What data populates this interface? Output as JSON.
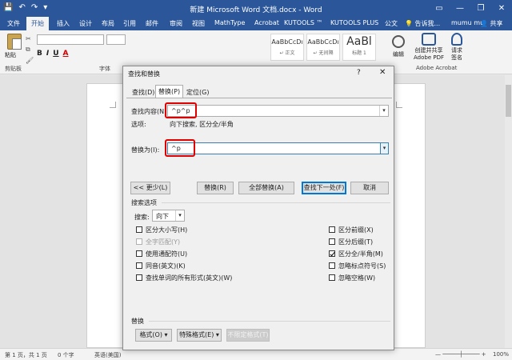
{
  "window": {
    "title": "新建 Microsoft Word 文档.docx - Word",
    "quick_access": [
      "💾",
      "↶",
      "↷",
      "▾"
    ],
    "controls": [
      "▭",
      "—",
      "❐",
      "✕"
    ]
  },
  "tabs": [
    {
      "label": "文件"
    },
    {
      "label": "开始"
    },
    {
      "label": "插入"
    },
    {
      "label": "设计"
    },
    {
      "label": "布局"
    },
    {
      "label": "引用"
    },
    {
      "label": "邮件"
    },
    {
      "label": "审阅"
    },
    {
      "label": "视图"
    },
    {
      "label": "MathType"
    },
    {
      "label": "Acrobat"
    },
    {
      "label": "KUTOOLS ™"
    },
    {
      "label": "KUTOOLS PLUS"
    },
    {
      "label": "公文"
    }
  ],
  "tell_me": "💡 告诉我...",
  "user": "mumu mu",
  "share": "👤 共享",
  "ribbon": {
    "paste_label": "粘贴",
    "clipboard_label": "剪贴板",
    "font_group_label": "字体",
    "bold": "B",
    "italic": "I",
    "underline": "U",
    "font_color": "A",
    "styles": [
      {
        "sample": "AaBbCcDı",
        "name": "↵ 正文"
      },
      {
        "sample": "AaBbCcDı",
        "name": "↵ 无间隔"
      },
      {
        "sample": "AaBl",
        "name": "标题 1"
      }
    ],
    "edit_label": "编辑",
    "pdf_label_1": "创建并共享",
    "pdf_label_2": "Adobe PDF",
    "sign_label_1": "请求",
    "sign_label_2": "签名",
    "acrobat_group_label": "Adobe Acrobat"
  },
  "status": {
    "page": "第 1 页，共 1 页",
    "words": "0 个字",
    "lang": "英语(美国)",
    "zoom": "100%"
  },
  "dialog": {
    "title": "查找和替换",
    "help": "?",
    "close": "✕",
    "tabs": [
      "查找(D)",
      "替换(P)",
      "定位(G)"
    ],
    "find_label": "查找内容(N):",
    "find_value": "^p^p",
    "options_label": "选项:",
    "options_value": "向下搜索, 区分全/半角",
    "replace_label": "替换为(I):",
    "replace_value": "^p",
    "buttons": {
      "less": "<< 更少(L)",
      "replace": "替换(R)",
      "replace_all": "全部替换(A)",
      "find_next": "查找下一处(F)",
      "cancel": "取消"
    },
    "search_options_label": "搜索选项",
    "search_label": "搜索:",
    "search_direction": "向下",
    "checkboxes_left": [
      {
        "label": "区分大小写(H)",
        "checked": false,
        "disabled": false
      },
      {
        "label": "全字匹配(Y)",
        "checked": false,
        "disabled": true
      },
      {
        "label": "使用通配符(U)",
        "checked": false,
        "disabled": false
      },
      {
        "label": "同音(英文)(K)",
        "checked": false,
        "disabled": false
      },
      {
        "label": "查找单词的所有形式(英文)(W)",
        "checked": false,
        "disabled": false
      }
    ],
    "checkboxes_right": [
      {
        "label": "区分前缀(X)",
        "checked": false,
        "disabled": false
      },
      {
        "label": "区分后缀(T)",
        "checked": false,
        "disabled": false
      },
      {
        "label": "区分全/半角(M)",
        "checked": true,
        "disabled": false
      },
      {
        "label": "忽略标点符号(S)",
        "checked": false,
        "disabled": false
      },
      {
        "label": "忽略空格(W)",
        "checked": false,
        "disabled": false
      }
    ],
    "replace_section_label": "替换",
    "format_btn": "格式(O) ▾",
    "special_btn": "特殊格式(E) ▾",
    "no_format_btn": "不限定格式(T)"
  }
}
